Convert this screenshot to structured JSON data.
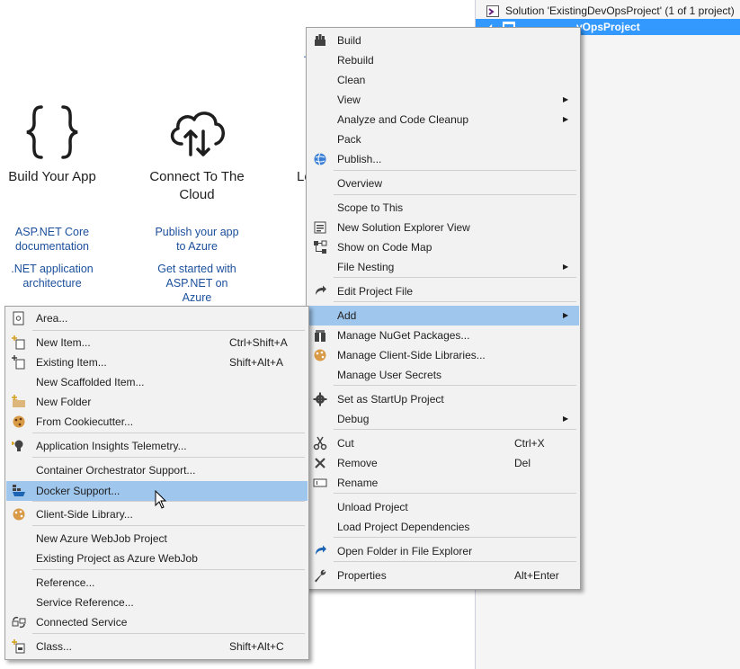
{
  "start_page": {
    "build": {
      "title": "Build Your App",
      "links": [
        "ASP.NET Core documentation",
        ".NET application architecture"
      ]
    },
    "cloud": {
      "title_line1": "Connect To The",
      "title_line2": "Cloud",
      "links": [
        "Publish your app to Azure",
        "Get started with ASP.NET on Azure"
      ]
    },
    "partial_title": "Le",
    "partial_dot": "."
  },
  "solution_explorer": {
    "solution_label": "Solution 'ExistingDevOpsProject' (1 of 1 project)",
    "project_label": "vOpsProject"
  },
  "project_menu": {
    "items": [
      {
        "label": "Build",
        "icon": "build-icon"
      },
      {
        "label": "Rebuild"
      },
      {
        "label": "Clean"
      },
      {
        "label": "View",
        "submenu": true
      },
      {
        "label": "Analyze and Code Cleanup",
        "submenu": true
      },
      {
        "label": "Pack"
      },
      {
        "label": "Publish...",
        "icon": "globe-icon"
      },
      {
        "label": "Overview"
      },
      {
        "label": "Scope to This"
      },
      {
        "label": "New Solution Explorer View",
        "icon": "solution-view-icon"
      },
      {
        "label": "Show on Code Map",
        "icon": "code-map-icon"
      },
      {
        "label": "File Nesting",
        "submenu": true
      },
      {
        "label": "Edit Project File",
        "icon": "edit-project-icon"
      },
      {
        "label": "Add",
        "submenu": true,
        "highlighted": true
      },
      {
        "label": "Manage NuGet Packages...",
        "icon": "nuget-icon"
      },
      {
        "label": "Manage Client-Side Libraries...",
        "icon": "client-lib-icon"
      },
      {
        "label": "Manage User Secrets"
      },
      {
        "label": "Set as StartUp Project",
        "icon": "gear-icon"
      },
      {
        "label": "Debug",
        "submenu": true
      },
      {
        "label": "Cut",
        "shortcut": "Ctrl+X",
        "icon": "scissors-icon"
      },
      {
        "label": "Remove",
        "shortcut": "Del",
        "icon": "close-icon"
      },
      {
        "label": "Rename",
        "icon": "rename-icon"
      },
      {
        "label": "Unload Project"
      },
      {
        "label": "Load Project Dependencies"
      },
      {
        "label": "Open Folder in File Explorer",
        "icon": "open-folder-icon"
      },
      {
        "label": "Properties",
        "shortcut": "Alt+Enter",
        "icon": "wrench-icon"
      }
    ]
  },
  "add_submenu": {
    "items": [
      {
        "label": "Area...",
        "icon": "area-icon"
      },
      {
        "label": "New Item...",
        "shortcut": "Ctrl+Shift+A",
        "icon": "new-item-icon"
      },
      {
        "label": "Existing Item...",
        "shortcut": "Shift+Alt+A",
        "icon": "existing-item-icon"
      },
      {
        "label": "New Scaffolded Item..."
      },
      {
        "label": "New Folder",
        "icon": "new-folder-icon"
      },
      {
        "label": "From Cookiecutter...",
        "icon": "cookiecutter-icon"
      },
      {
        "label": "Application Insights Telemetry...",
        "icon": "app-insights-icon"
      },
      {
        "label": "Container Orchestrator Support..."
      },
      {
        "label": "Docker Support...",
        "icon": "docker-icon",
        "highlighted": true
      },
      {
        "label": "Client-Side Library...",
        "icon": "client-lib-icon"
      },
      {
        "label": "New Azure WebJob Project"
      },
      {
        "label": "Existing Project as Azure WebJob"
      },
      {
        "label": "Reference..."
      },
      {
        "label": "Service Reference..."
      },
      {
        "label": "Connected Service",
        "icon": "connected-service-icon"
      },
      {
        "label": "Class...",
        "shortcut": "Shift+Alt+C",
        "icon": "class-icon"
      }
    ]
  }
}
